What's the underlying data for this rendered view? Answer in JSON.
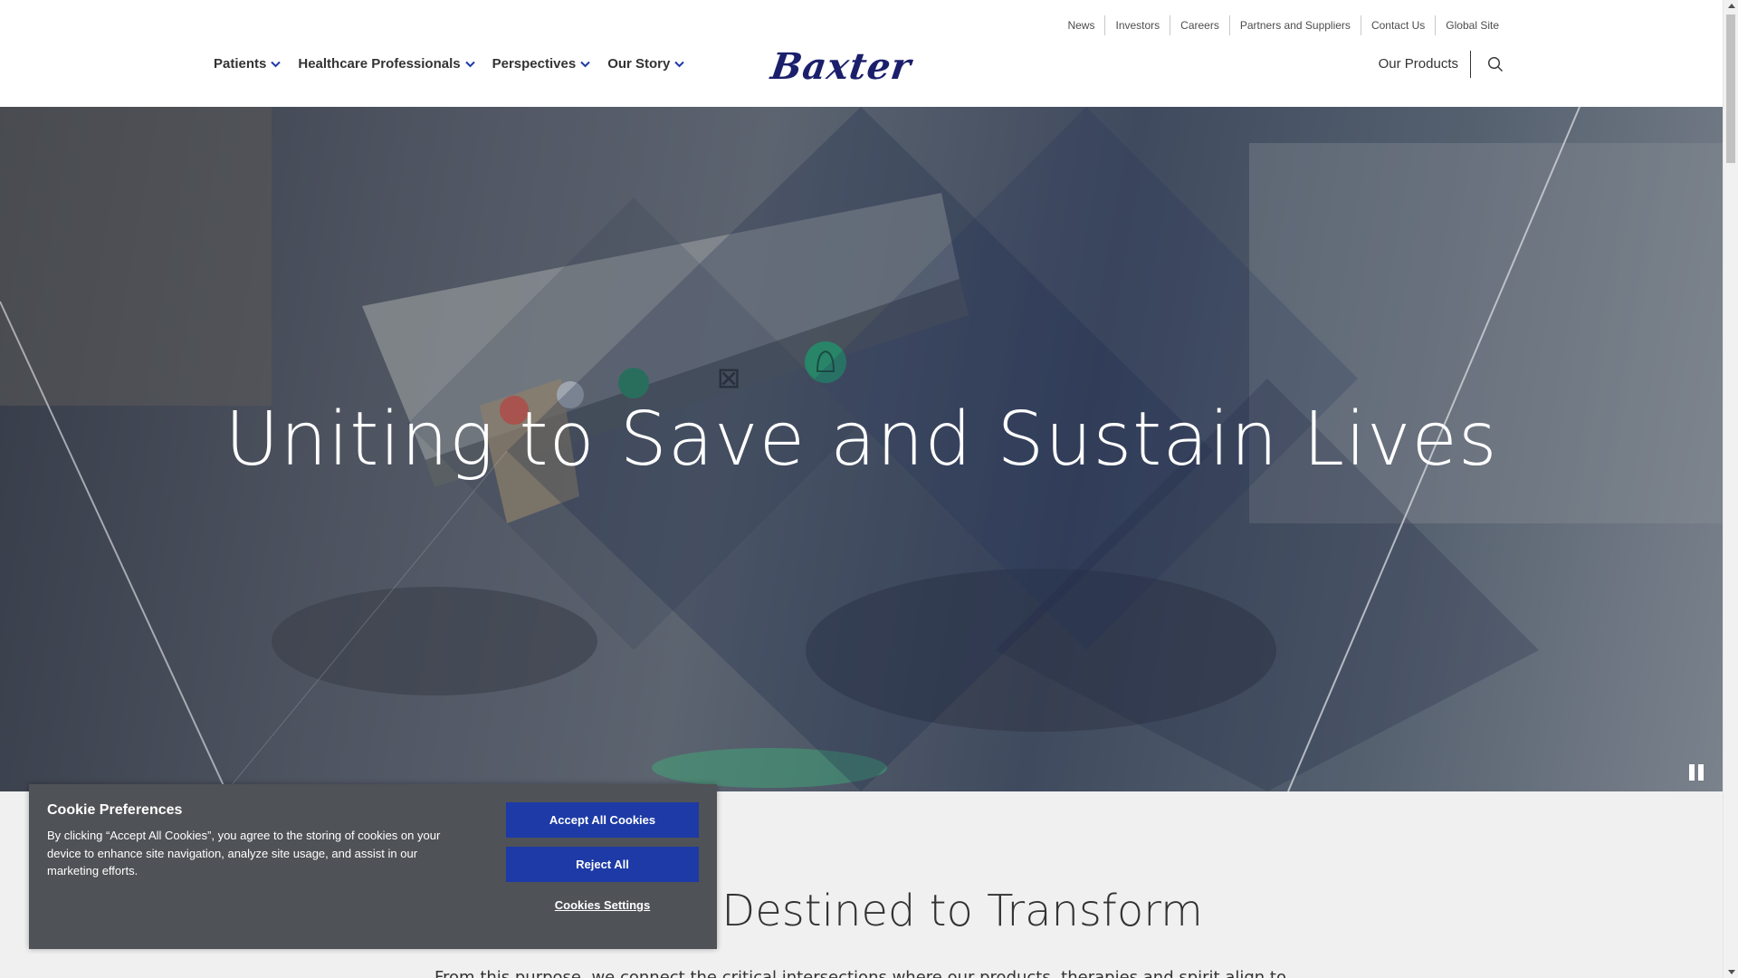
{
  "header": {
    "utility_nav": [
      "News",
      "Investors",
      "Careers",
      "Partners and Suppliers",
      "Contact Us",
      "Global Site"
    ],
    "main_nav": [
      "Patients",
      "Healthcare Professionals",
      "Perspectives",
      "Our Story"
    ],
    "logo_text": "Baxter",
    "products_label": "Our Products",
    "search_icon": "search-icon",
    "brand_color": "#1b1f6b"
  },
  "hero": {
    "title": "Uniting to Save and Sustain Lives",
    "pause_icon": "pause-icon"
  },
  "section": {
    "heading": "Purpose, Destined to Transform",
    "body": "From this purpose, we connect the critical intersections where our products, therapies and spirit align to meet the healthcare"
  },
  "cookie": {
    "title": "Cookie Preferences",
    "text": "By clicking “Accept All Cookies”, you agree to the storing of cookies on your device to enhance site navigation, analyze site usage, and assist in our marketing efforts.",
    "accept_label": "Accept All Cookies",
    "reject_label": "Reject All",
    "settings_label": "Cookies Settings",
    "button_color": "#1d3aa6"
  }
}
